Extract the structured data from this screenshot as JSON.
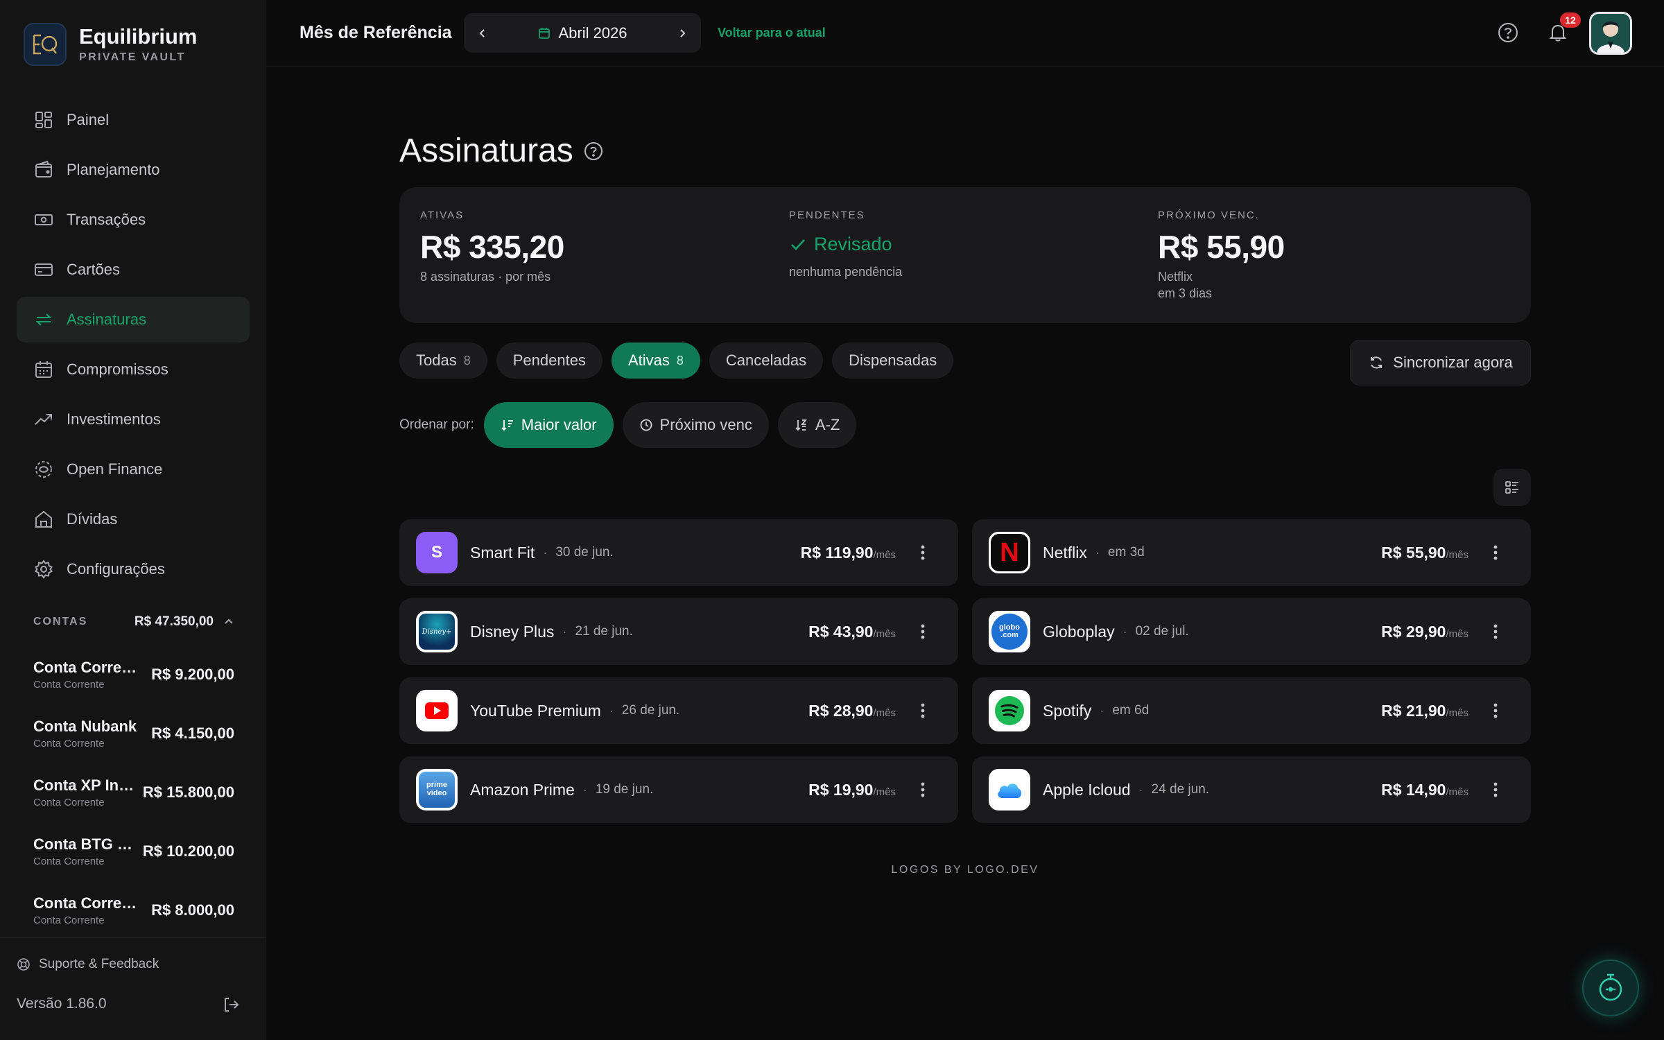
{
  "brand": {
    "name": "Equilibrium",
    "sub": "PRIVATE VAULT"
  },
  "nav": [
    {
      "label": "Painel",
      "icon": "grid-icon"
    },
    {
      "label": "Planejamento",
      "icon": "wallet-icon"
    },
    {
      "label": "Transações",
      "icon": "cash-icon"
    },
    {
      "label": "Cartões",
      "icon": "credit-card-icon"
    },
    {
      "label": "Assinaturas",
      "icon": "repeat-icon",
      "active": true
    },
    {
      "label": "Compromissos",
      "icon": "calendar-icon"
    },
    {
      "label": "Investimentos",
      "icon": "trending-up-icon"
    },
    {
      "label": "Open Finance",
      "icon": "open-finance-icon"
    },
    {
      "label": "Dívidas",
      "icon": "home-icon"
    },
    {
      "label": "Configurações",
      "icon": "settings-icon"
    }
  ],
  "accounts": {
    "label": "CONTAS",
    "total": "R$ 47.350,00",
    "items": [
      {
        "name": "Conta Corrente ...",
        "type": "Conta Corrente",
        "value": "R$ 9.200,00"
      },
      {
        "name": "Conta Nubank",
        "type": "Conta Corrente",
        "value": "R$ 4.150,00"
      },
      {
        "name": "Conta XP Inv...",
        "type": "Conta Corrente",
        "value": "R$ 15.800,00"
      },
      {
        "name": "Conta BTG Pa...",
        "type": "Conta Corrente",
        "value": "R$ 10.200,00"
      },
      {
        "name": "Conta Corrente ...",
        "type": "Conta Corrente",
        "value": "R$ 8.000,00"
      }
    ]
  },
  "support": "Suporte & Feedback",
  "version": "Versão 1.86.0",
  "topbar": {
    "ref_label": "Mês de Referência",
    "month": "Abril 2026",
    "back_now": "Voltar para o atual",
    "notifications": "12"
  },
  "page": {
    "title": "Assinaturas"
  },
  "summary": {
    "active": {
      "label": "ATIVAS",
      "value": "R$ 335,20",
      "sub": "8 assinaturas · por mês"
    },
    "pending": {
      "label": "PENDENTES",
      "status": "Revisado",
      "sub": "nenhuma pendência"
    },
    "next": {
      "label": "PRÓXIMO VENC.",
      "value": "R$ 55,90",
      "sub1": "Netflix",
      "sub2": "em 3 dias"
    }
  },
  "filters": [
    {
      "label": "Todas",
      "count": "8"
    },
    {
      "label": "Pendentes",
      "count": ""
    },
    {
      "label": "Ativas",
      "count": "8",
      "active": true
    },
    {
      "label": "Canceladas",
      "count": ""
    },
    {
      "label": "Dispensadas",
      "count": ""
    }
  ],
  "sync_label": "Sincronizar agora",
  "sort": {
    "label": "Ordenar por:",
    "options": [
      {
        "label": "Maior valor",
        "icon": "sort-desc-icon",
        "active": true
      },
      {
        "label": "Próximo venc",
        "icon": "clock-icon"
      },
      {
        "label": "A-Z",
        "icon": "sort-az-icon"
      }
    ]
  },
  "subscriptions": [
    {
      "name": "Smart Fit",
      "date": "30 de jun.",
      "price": "R$ 119,90",
      "per": "/mês",
      "logo": "smartfit-logo",
      "letter": "S"
    },
    {
      "name": "Netflix",
      "date": "em 3d",
      "price": "R$ 55,90",
      "per": "/mês",
      "logo": "netflix-logo",
      "letter": "N"
    },
    {
      "name": "Disney Plus",
      "date": "21 de jun.",
      "price": "R$ 43,90",
      "per": "/mês",
      "logo": "disney-logo",
      "letter": "Disney+"
    },
    {
      "name": "Globoplay",
      "date": "02 de jul.",
      "price": "R$ 29,90",
      "per": "/mês",
      "logo": "globoplay-logo",
      "letter": "globo .com"
    },
    {
      "name": "YouTube Premium",
      "date": "26 de jun.",
      "price": "R$ 28,90",
      "per": "/mês",
      "logo": "youtube-logo",
      "letter": ""
    },
    {
      "name": "Spotify",
      "date": "em 6d",
      "price": "R$ 21,90",
      "per": "/mês",
      "logo": "spotify-logo",
      "letter": ""
    },
    {
      "name": "Amazon Prime",
      "date": "19 de jun.",
      "price": "R$ 19,90",
      "per": "/mês",
      "logo": "prime-logo",
      "letter": "prime video"
    },
    {
      "name": "Apple Icloud",
      "date": "24 de jun.",
      "price": "R$ 14,90",
      "per": "/mês",
      "logo": "icloud-logo",
      "letter": ""
    }
  ],
  "footnote": "LOGOS BY LOGO.DEV",
  "colors": {
    "accent": "#17a56d",
    "accent_bg": "#0f7a55",
    "bg": "#0b0b0c",
    "sidebar": "#141415",
    "card": "#1b1b1d",
    "badge": "#d9292f"
  }
}
